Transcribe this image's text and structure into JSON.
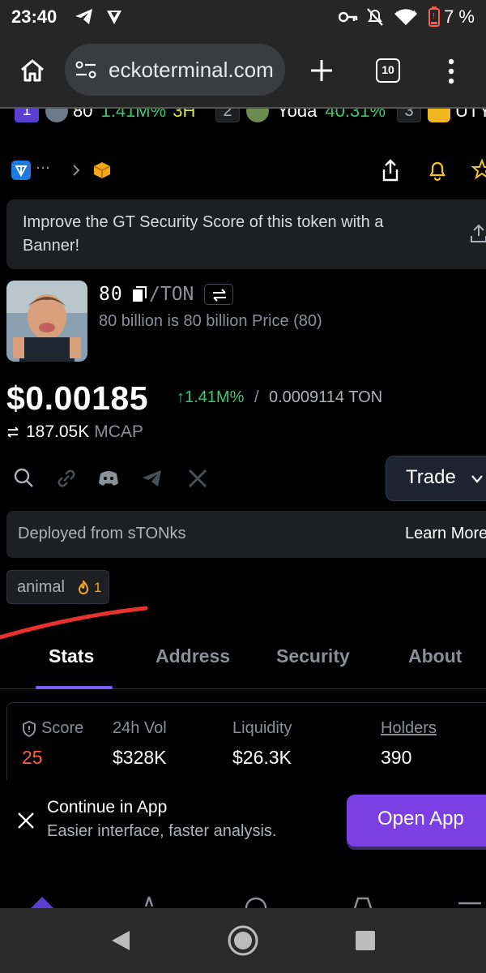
{
  "status_bar": {
    "time": "23:40",
    "battery": "7 %",
    "icons": [
      "telegram-icon",
      "signal-app-icon",
      "key-icon",
      "bell-off-icon",
      "wifi-icon",
      "battery-low-icon"
    ]
  },
  "browser": {
    "url": "eckoterminal.com",
    "tab_count": "10",
    "icons": [
      "home-icon",
      "site-settings-icon",
      "new-tab-icon",
      "menu-icon"
    ]
  },
  "ticker": {
    "items": [
      {
        "rank": "1",
        "name": "80",
        "change": "1.41M%",
        "age": "3H"
      },
      {
        "rank": "2",
        "name": "Yoda",
        "change": "40.31%"
      },
      {
        "rank": "3",
        "name": "UTY"
      }
    ]
  },
  "breadcrumb": {
    "ellipsis": "···"
  },
  "banner": {
    "text": "Improve the GT Security Score of this token with a Banner!"
  },
  "token": {
    "symbol": "80",
    "pair": "/TON",
    "name": "80 billion is 80 billion Price (80)",
    "price": "$0.00185",
    "change": "↑1.41M%",
    "separator": "/",
    "price_ton": "0.0009114 TON",
    "mcap_value": "187.05K",
    "mcap_label": "MCAP"
  },
  "actions": {
    "trade_label": "Trade"
  },
  "deployed": {
    "text": "Deployed from sTONks",
    "link": "Learn More"
  },
  "tag": {
    "label": "animal",
    "count": "1"
  },
  "tabs": [
    "Stats",
    "Address",
    "Security",
    "About"
  ],
  "stats": {
    "score_label": "Score",
    "score_value": "25",
    "vol_label": "24h Vol",
    "vol_value": "$328K",
    "liq_label": "Liquidity",
    "liq_value": "$26.3K",
    "holders_label": "Holders",
    "holders_value": "390"
  },
  "app_prompt": {
    "title": "Continue in App",
    "subtitle": "Easier interface, faster analysis.",
    "button": "Open App"
  },
  "colors": {
    "accent": "#7b3fe4",
    "positive": "#37c96b",
    "score_red": "#ff5a4f",
    "annotation_red": "#e8322e"
  }
}
